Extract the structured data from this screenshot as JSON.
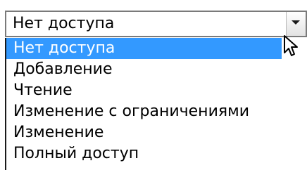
{
  "select": {
    "value": "Нет доступа"
  },
  "options": [
    {
      "label": "Нет доступа",
      "selected": true
    },
    {
      "label": "Добавление",
      "selected": false
    },
    {
      "label": "Чтение",
      "selected": false
    },
    {
      "label": "Изменение с ограничениями",
      "selected": false
    },
    {
      "label": "Изменение",
      "selected": false
    },
    {
      "label": "Полный доступ",
      "selected": false
    }
  ],
  "colors": {
    "highlight": "#3399ff",
    "highlight_text": "#ffffff",
    "text": "#000000",
    "border": "#7a7a7a"
  },
  "icons": {
    "dropdown_arrow": "chevron-down-icon",
    "cursor": "mouse-pointer-icon"
  }
}
